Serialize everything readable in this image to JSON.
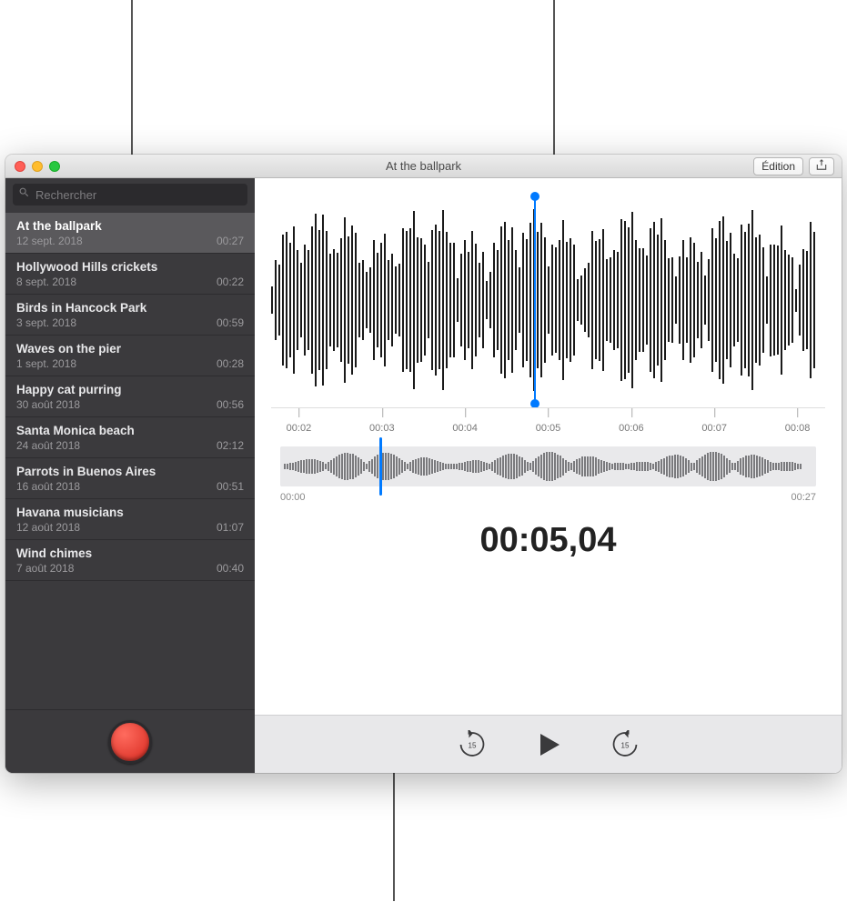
{
  "window": {
    "title": "At the ballpark",
    "edit_label": "Édition"
  },
  "search": {
    "placeholder": "Rechercher"
  },
  "recordings": [
    {
      "title": "At the ballpark",
      "date": "12 sept. 2018",
      "duration": "00:27",
      "selected": true
    },
    {
      "title": "Hollywood Hills crickets",
      "date": "8 sept. 2018",
      "duration": "00:22"
    },
    {
      "title": "Birds in Hancock Park",
      "date": "3 sept. 2018",
      "duration": "00:59"
    },
    {
      "title": "Waves on the pier",
      "date": "1 sept. 2018",
      "duration": "00:28"
    },
    {
      "title": "Happy cat purring",
      "date": "30 août 2018",
      "duration": "00:56"
    },
    {
      "title": "Santa Monica beach",
      "date": "24 août 2018",
      "duration": "02:12"
    },
    {
      "title": "Parrots in Buenos Aires",
      "date": "16 août 2018",
      "duration": "00:51"
    },
    {
      "title": "Havana musicians",
      "date": "12 août 2018",
      "duration": "01:07"
    },
    {
      "title": "Wind chimes",
      "date": "7 août 2018",
      "duration": "00:40"
    }
  ],
  "timeline": {
    "ticks": [
      "00:02",
      "00:03",
      "00:04",
      "00:05",
      "00:06",
      "00:07",
      "00:08"
    ],
    "playhead_percent": 47.5
  },
  "overview": {
    "start_label": "00:00",
    "end_label": "00:27",
    "playhead_percent": 18.5
  },
  "current_time": "00:05,04",
  "controls": {
    "back_label": "15",
    "forward_label": "15"
  },
  "colors": {
    "accent": "#007aff",
    "record": "#ff3b30"
  }
}
